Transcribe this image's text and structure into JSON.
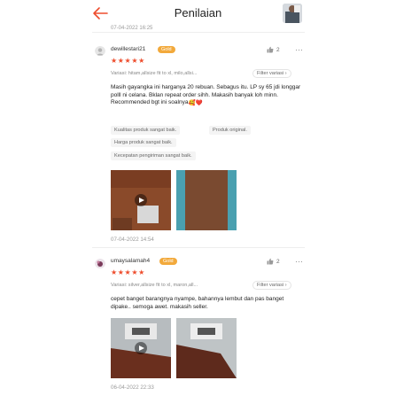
{
  "header": {
    "title": "Penilaian",
    "accent": "#ee4d2d"
  },
  "top_cut_date": "07-04-2022 16:25",
  "reviews": [
    {
      "username": "dewillestari21",
      "badge": "Gold",
      "likes": "2",
      "rating": "★★★★★",
      "variant": "Variasi: hitam,allsize fit to xl, milo,allsi...",
      "filter": "Filter variasi",
      "text": "Masih gayangka ini harganya 20 rebuan. Sebagus itu. LP sy 65 jdi longgar polll ni celana. Bklan repeat order sihh. Makasih banyak loh minn. Recommended bgt ini soalnya",
      "emoji": "🥰❤️",
      "tags": [
        "Kualitas produk sangat baik.",
        "Produk original.",
        "Harga produk sangat baik.",
        "Kecepatan pengiriman sangat baik."
      ],
      "date": "07-04-2022 14:54"
    },
    {
      "username": "umaysalamah4",
      "badge": "Gold",
      "likes": "2",
      "rating": "★★★★★",
      "variant": "Variasi: silver,allsize fit to xl, maron,all...",
      "filter": "Filter variasi",
      "text": "cepet banget barangnya nyampe,  bahannya lembut dan pas banget dipake.. semoga awet.  makasih seller.",
      "date": "06-04-2022 22:33"
    }
  ],
  "colors": {
    "star": "#ee4d2d",
    "badge": "#f2a93b"
  }
}
